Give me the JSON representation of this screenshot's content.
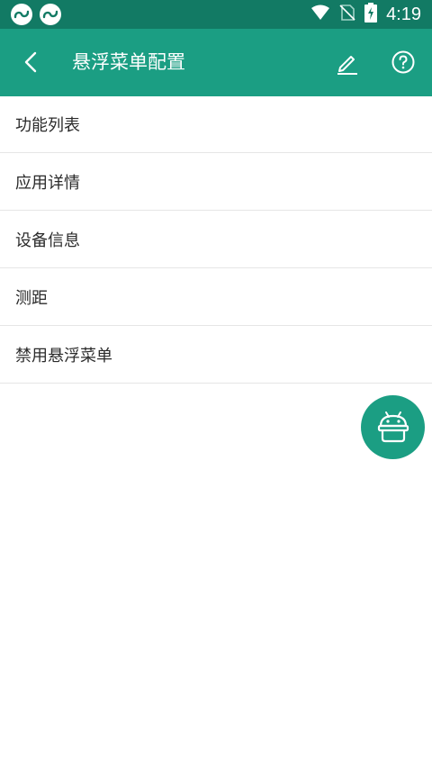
{
  "status_bar": {
    "time": "4:19",
    "notification_icons": [
      "app-notification-icon",
      "app-notification-icon"
    ],
    "status_icons": [
      "wifi-icon",
      "no-sim-icon",
      "battery-charging-icon"
    ]
  },
  "app_bar": {
    "title": "悬浮菜单配置",
    "back_icon": "back-arrow-icon",
    "edit_icon": "edit-pencil-icon",
    "help_icon": "help-icon"
  },
  "menu": {
    "items": [
      {
        "label": "功能列表"
      },
      {
        "label": "应用详情"
      },
      {
        "label": "设备信息"
      },
      {
        "label": "测距"
      },
      {
        "label": "禁用悬浮菜单"
      }
    ]
  },
  "fab": {
    "icon": "android-robot-icon"
  },
  "colors": {
    "status_bar": "#127a64",
    "app_bar": "#1b9e83",
    "fab": "#1b9e83",
    "divider": "#e6e6e6"
  }
}
